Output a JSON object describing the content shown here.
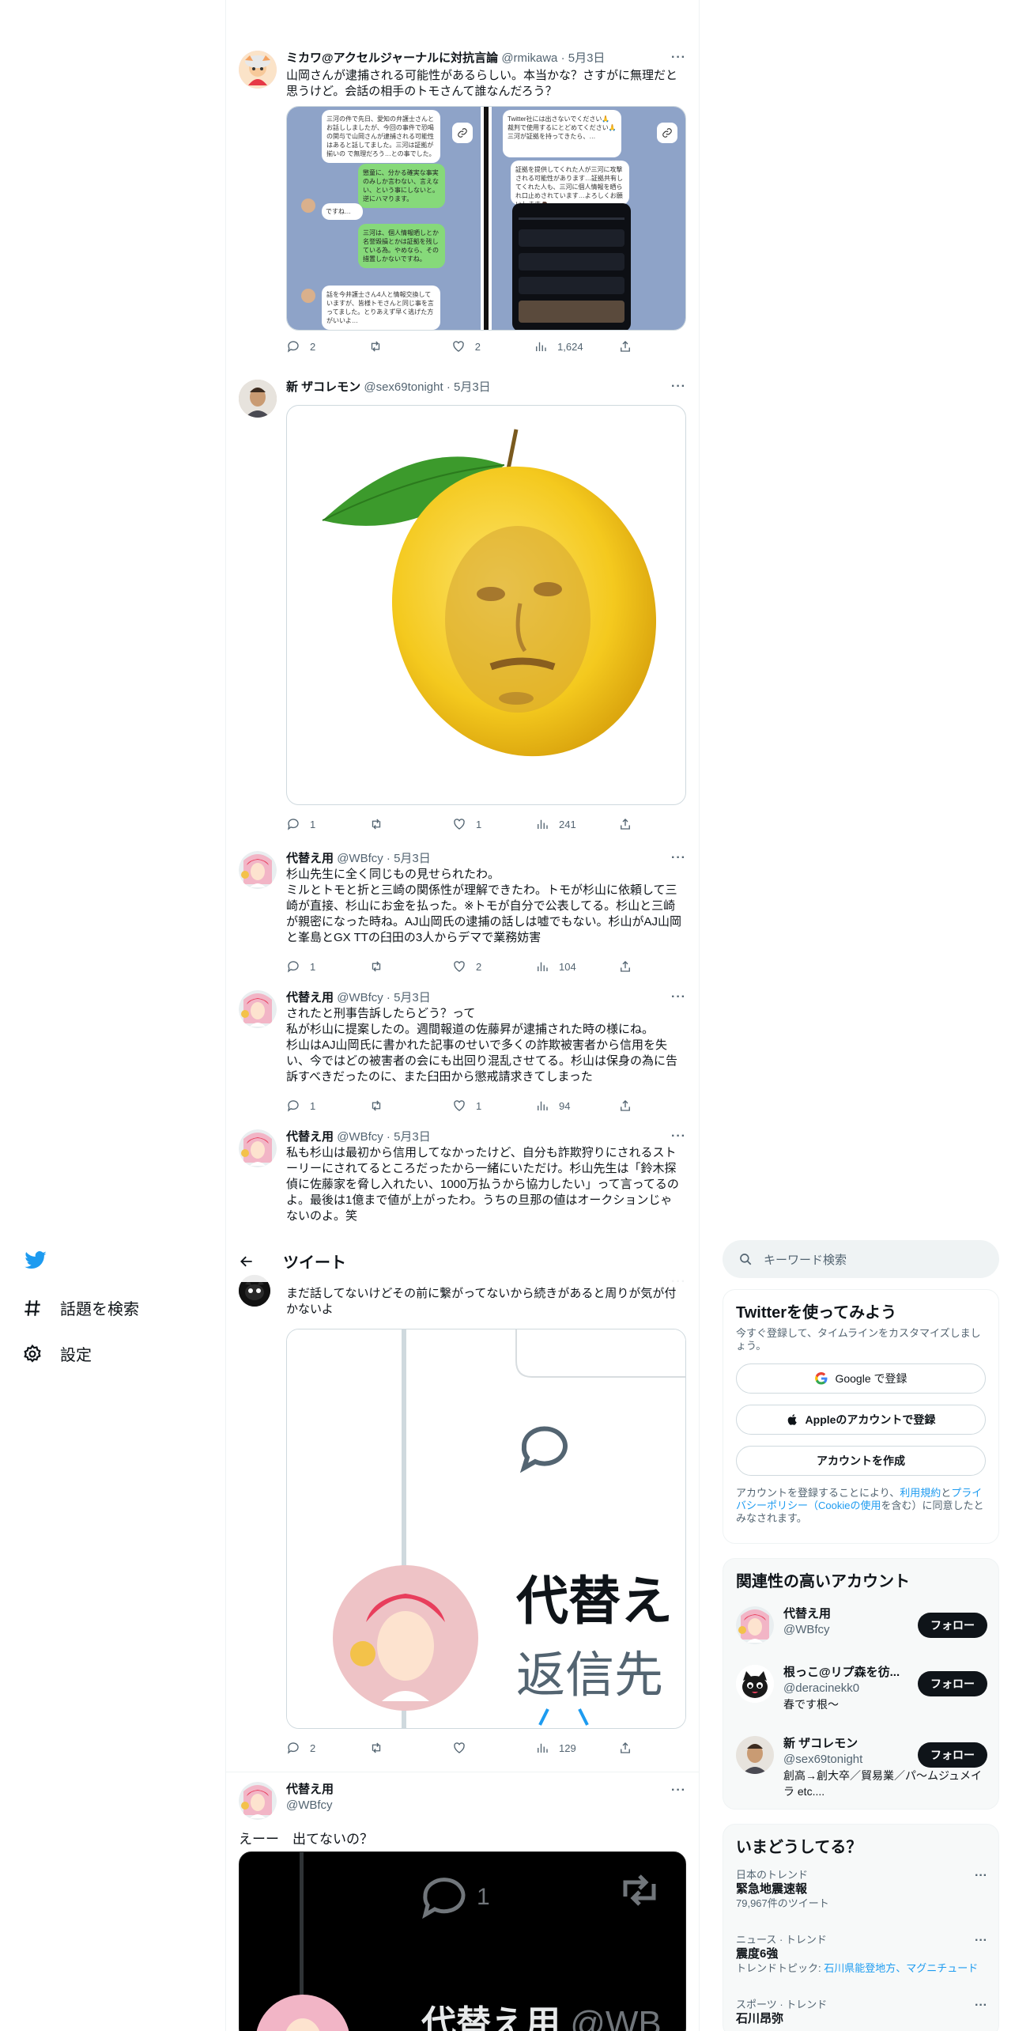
{
  "nav": {
    "explore": "話題を検索",
    "settings": "設定"
  },
  "header": {
    "title": "ツイート"
  },
  "tweets": [
    {
      "name": "ミカワ@アクセルジャーナルに対抗言論",
      "handle": "@rmikawa",
      "date": "· 5月3日",
      "text": "山岡さんが逮捕される可能性があるらしい。本当かな？さすがに無理だと思うけど。会話の相手のトモさんて誰なんだろう？",
      "replies": "2",
      "retweets": "",
      "likes": "2",
      "views": "1,624",
      "chat": {
        "msg1": "三河の件で先日、愛知の弁護士さんとお話ししましたが、今回の事件で恐喝の関与で山岡さんが逮捕される可能性はあると話してました。三河は証拠が揃いの で無理だろう…との事でした。",
        "msg2": "懲童に、分かる確実な事実のみしか言わない、言えない、という事にしないと。逆にハマります。",
        "msg3": "ですね…",
        "msg4": "三河は、個人情報晒しとか名誉毀損とかは証拠を残している為。やめなら、その措置しかないですね。",
        "msg5": "話を今井護士さん4人と情報交換していますが、皆様トモさんと同じ事を言ってました。とりあえず早く逃げた方がいいよ…",
        "msg6": "Twitter社には出さないでください🙏 裁判で使用するにとどめてください🙏 三河が証拠を持ってきたら、…",
        "msg7": "証拠を提供してくれた人が三河に攻撃される可能性があります…証拠共有してくれた人も、三河に個人情報を晒られ口止めされています…よろしくお願いします🙇"
      }
    },
    {
      "name": "新 ザコレモン",
      "handle": "@sex69tonight",
      "date": "· 5月3日",
      "text": "",
      "replies": "1",
      "retweets": "",
      "likes": "1",
      "views": "241"
    },
    {
      "name": "代替え用",
      "handle": "@WBfcy",
      "date": "· 5月3日",
      "text": "杉山先生に全く同じもの見せられたわ。\nミルとトモと折と三崎の関係性が理解できたわ。トモが杉山に依頼して三崎が直接、杉山にお金を払った。※トモが自分で公表してる。杉山と三崎が親密になった時ね。AJ山岡氏の逮捕の話しは嘘でもない。杉山がAJ山岡と峯島とGX TTの臼田の3人からデマで業務妨害",
      "replies": "1",
      "retweets": "",
      "likes": "2",
      "views": "104"
    },
    {
      "name": "代替え用",
      "handle": "@WBfcy",
      "date": "· 5月3日",
      "text": "されたと刑事告訴したらどう？って\n私が杉山に提案したの。週間報道の佐藤昇が逮捕された時の様にね。\n杉山はAJ山岡氏に書かれた記事のせいで多くの詐欺被害者から信用を失い、今ではどの被害者の会にも出回り混乱させてる。杉山は保身の為に告訴すべきだったのに、また臼田から懲戒請求きてしまった",
      "replies": "1",
      "retweets": "",
      "likes": "1",
      "views": "94"
    },
    {
      "name": "代替え用",
      "handle": "@WBfcy",
      "date": "· 5月3日",
      "text": "私も杉山は最初から信用してなかったけど、自分も詐欺狩りにされるストーリーにされてるところだったから一緒にいただけ。杉山先生は「鈴木探偵に佐藤家を脅し入れたい、1000万払うから協力したい」って言ってるのよ。最後は1億まで値が上がったわ。うちの旦那の値はオークションじゃないのよ。笑"
    },
    {
      "text": "まだ話してないけどその前に繋がってないから続きがあると周りが気が付かないよ",
      "replies": "2",
      "retweets": "",
      "likes": "",
      "views": "129",
      "card": {
        "name": "代替え",
        "sub": "返信先",
        "count": ""
      }
    },
    {
      "name": "代替え用",
      "handle": "@WBfcy",
      "text": "えーー　出てないの？",
      "card": {
        "count": "1",
        "name": "代替え用",
        "handle": "@WB"
      }
    }
  ],
  "right": {
    "search_placeholder": "キーワード検索",
    "signup": {
      "title": "Twitterを使ってみよう",
      "desc": "今すぐ登録して、タイムラインをカスタマイズしましょう。",
      "google": "Google で登録",
      "apple": "Appleのアカウントで登録",
      "create": "アカウントを作成",
      "legal_1": "アカウントを登録することにより、",
      "legal_terms": "利用規約",
      "legal_2": "と",
      "legal_privacy": "プライバシーポリシー（Cookieの使用",
      "legal_3": "を含む）に同意したとみなされます。"
    },
    "relevant": {
      "title": "関連性の高いアカウント",
      "follow_label": "フォロー",
      "accounts": [
        {
          "name": "代替え用",
          "handle": "@WBfcy",
          "bio": ""
        },
        {
          "name": "根っこ@リプ森を彷...",
          "handle": "@deracinekk0",
          "bio": "春です根～"
        },
        {
          "name": "新 ザコレモン",
          "handle": "@sex69tonight",
          "bio": "創高→創大卒／貿易業／パ〜ムジュメイラ etc...."
        }
      ]
    },
    "trends": {
      "title": "いまどうしてる？",
      "items": [
        {
          "context": "日本のトレンド",
          "title": "緊急地震速報",
          "meta": "79,967件のツイート"
        },
        {
          "context": "ニュース · トレンド",
          "title": "震度6強",
          "meta_prefix": "トレンドトピック: ",
          "meta_links": "石川県能登地方、マグニチュード"
        },
        {
          "context": "スポーツ · トレンド",
          "title": "石川昂弥"
        }
      ]
    }
  }
}
